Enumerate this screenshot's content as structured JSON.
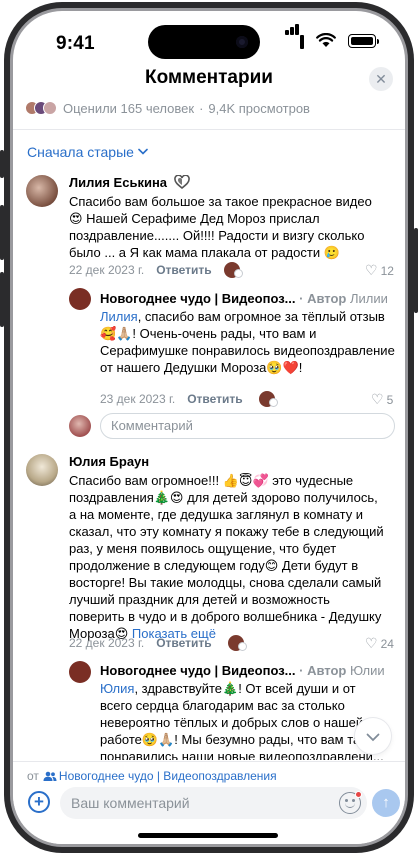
{
  "status_bar": {
    "time": "9:41"
  },
  "header": {
    "title": "Комментарии",
    "close_icon": "✕"
  },
  "stats": {
    "rated": "Оценили 165 человек",
    "separator": "·",
    "views": "9,4K просмотров"
  },
  "sort": {
    "label": "Сначала старые",
    "chevron": "⌄"
  },
  "comments": [
    {
      "author": "Лилия Еськина",
      "text": "Спасибо вам большое за такое прекрасное видео 😍 Нашей Серафиме Дед Мороз прислал поздравление....... Ой!!!! Радости и визгу сколько было ... а Я как мама плакала от радости 🥲",
      "date": "22 дек 2023 г.",
      "reply_label": "Ответить",
      "likes": "12",
      "reply": {
        "author": "Новогоднее чудо | Видеопоз...",
        "author_suffix": "· Автор",
        "reply_to": "Лилии",
        "mention": "Лилия",
        "text": ", спасибо вам огромное за тёплый отзыв 🥰🙏🏼! Очень-очень рады, что вам и Серафимушке понравилось видеопоздравление от нашего Дедушки Мороза🥹❤️!",
        "date": "23 дек 2023 г.",
        "reply_label": "Ответить",
        "likes": "5"
      }
    },
    {
      "author": "Юлия Браун",
      "text": "Спасибо вам огромное!!! 👍😇💞 это чудесные поздравления🎄😍 для детей здорово получилось, а на моменте, где дедушка заглянул в комнату и сказал, что эту комнату я покажу тебе в следующий раз, у меня появилось ощущение, что будет продолжение в следующем году😊 Дети будут в восторге! Вы такие молодцы, снова сделали самый лучший праздник для детей и возможность поверить в чудо и в доброго волшебника - Дедушку Мороза😍",
      "show_more": "Показать ещё",
      "date": "22 дек 2023 г.",
      "reply_label": "Ответить",
      "likes": "24",
      "reply": {
        "author": "Новогоднее чудо | Видеопоз...",
        "author_suffix": "· Автор",
        "reply_to": "Юлии",
        "mention": "Юлия",
        "text": ", здравствуйте🎄! От всей души и от всего сердца благодарим вас за столько невероятно тёплых и добрых слов о нашей работе🥹🙏🏼! Мы безумно рады, что вам та... понравились наши новые видеопоздравлени..."
      }
    }
  ],
  "inline_comment_placeholder": "Комментарий",
  "bottom": {
    "from_prefix": "от",
    "group_name": "Новогоднее чудо | Видеопоздравления",
    "input_placeholder": "Ваш комментарий",
    "plus_icon": "+",
    "send_icon": "↑",
    "scroll_down_icon": "⌄"
  },
  "colors": {
    "accent": "#2a6fc9",
    "muted": "#8b9299",
    "send_disabled": "#a9c8ef"
  }
}
